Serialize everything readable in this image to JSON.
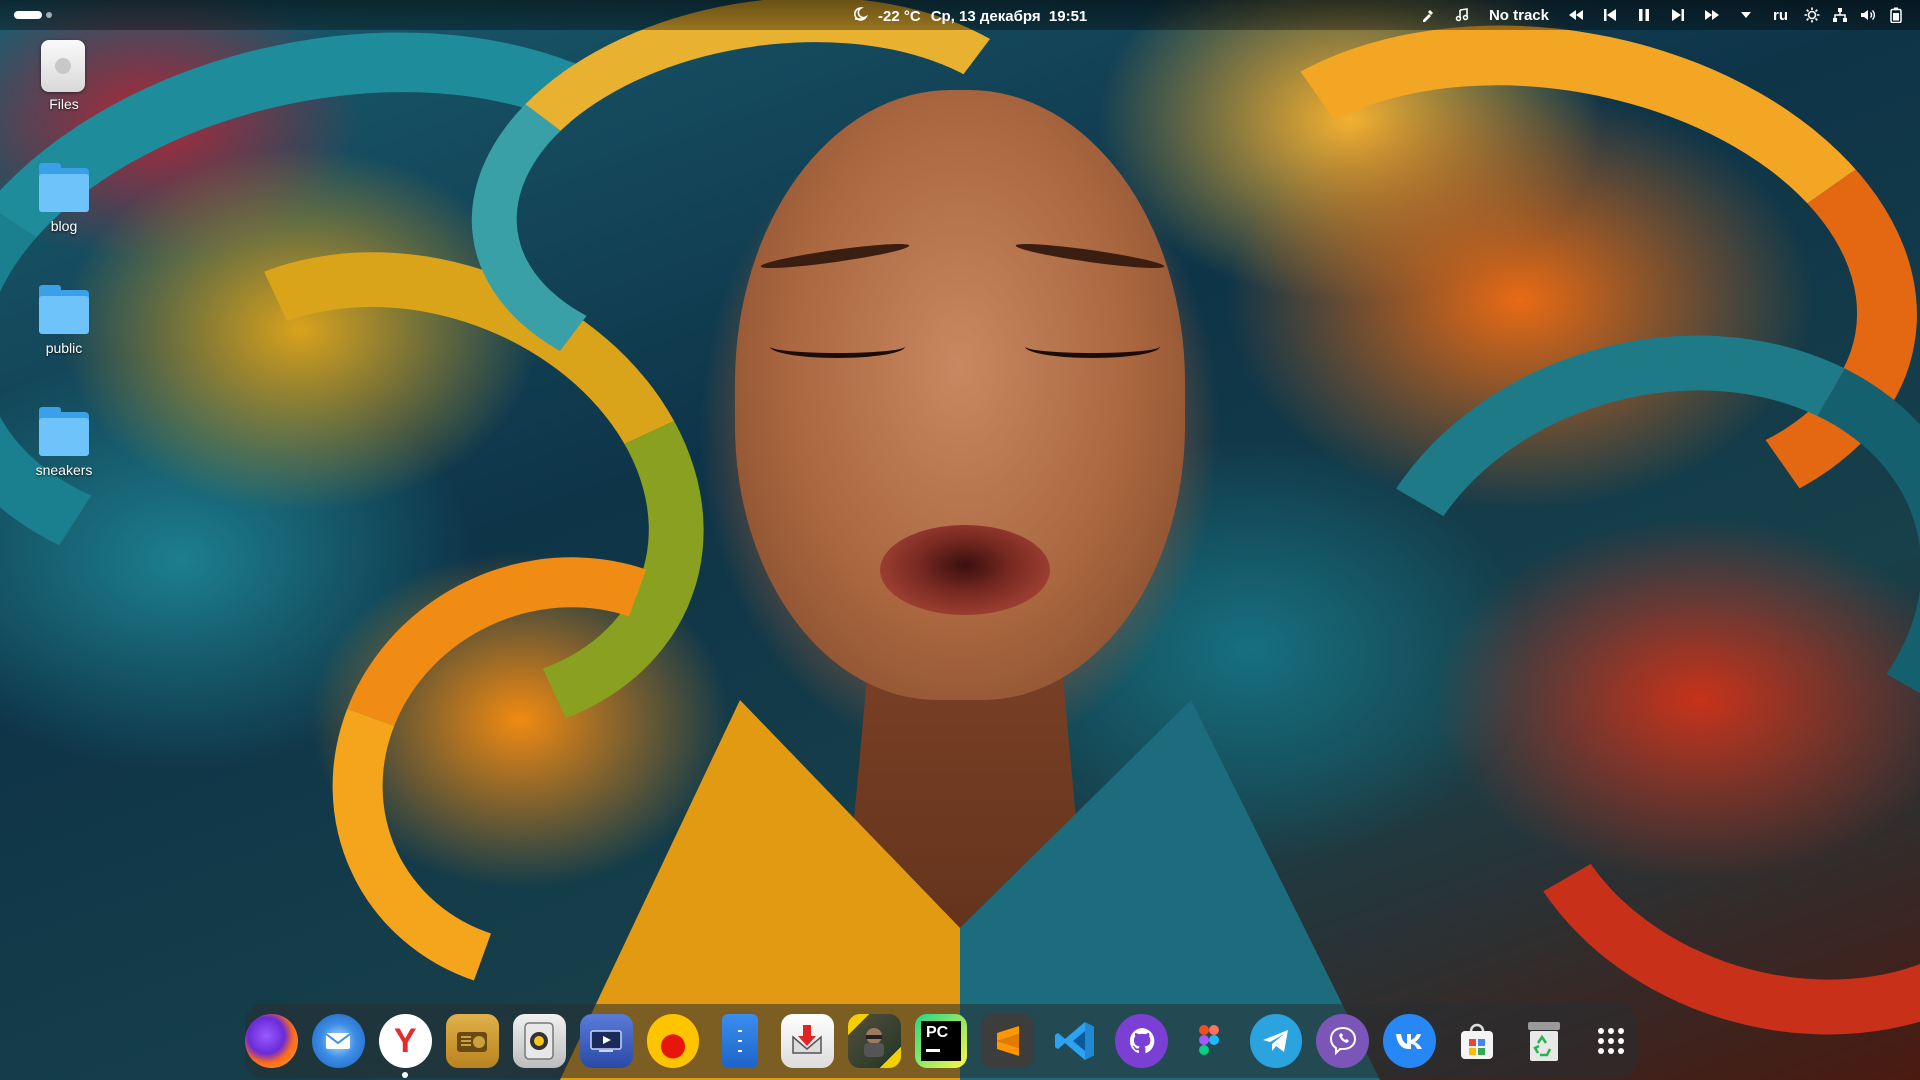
{
  "topbar": {
    "weather_icon": "weather-night-icon",
    "temperature": "-22 °C",
    "datetime": "Ср, 13 декабря  19:51",
    "color_picker_icon": "eyedropper-icon",
    "music_icon": "music-note-icon",
    "track": "No track",
    "media_controls": [
      "seek-backward-icon",
      "previous-track-icon",
      "pause-icon",
      "next-track-icon",
      "seek-forward-icon"
    ],
    "menu_arrow_icon": "chevron-down-icon",
    "language": "ru",
    "status_icons": [
      "brightness-icon",
      "network-icon",
      "volume-icon",
      "battery-icon"
    ]
  },
  "desktop": {
    "icons": [
      {
        "label": "Files",
        "icon": "drive-icon"
      },
      {
        "label": "blog",
        "icon": "folder-icon"
      },
      {
        "label": "public",
        "icon": "folder-icon"
      },
      {
        "label": "sneakers",
        "icon": "folder-icon"
      }
    ]
  },
  "dock": {
    "apps": [
      {
        "name": "firefox",
        "running": false
      },
      {
        "name": "thunderbird",
        "running": false
      },
      {
        "name": "yandex-browser",
        "running": true
      },
      {
        "name": "radio",
        "running": false
      },
      {
        "name": "speaker",
        "running": false
      },
      {
        "name": "screen-recorder",
        "running": false
      },
      {
        "name": "music-player",
        "running": false
      },
      {
        "name": "file-manager",
        "running": false
      },
      {
        "name": "downloader",
        "running": false
      },
      {
        "name": "game",
        "running": false
      },
      {
        "name": "pycharm",
        "running": false
      },
      {
        "name": "sublime-text",
        "running": false
      },
      {
        "name": "vscode",
        "running": false
      },
      {
        "name": "github-desktop",
        "running": false
      },
      {
        "name": "figma",
        "running": false
      },
      {
        "name": "telegram",
        "running": false
      },
      {
        "name": "viber",
        "running": false
      },
      {
        "name": "vk",
        "running": false
      },
      {
        "name": "app-store",
        "running": false
      },
      {
        "name": "trash",
        "running": false
      },
      {
        "name": "app-grid",
        "running": false
      }
    ],
    "pycharm_label": "PC"
  }
}
